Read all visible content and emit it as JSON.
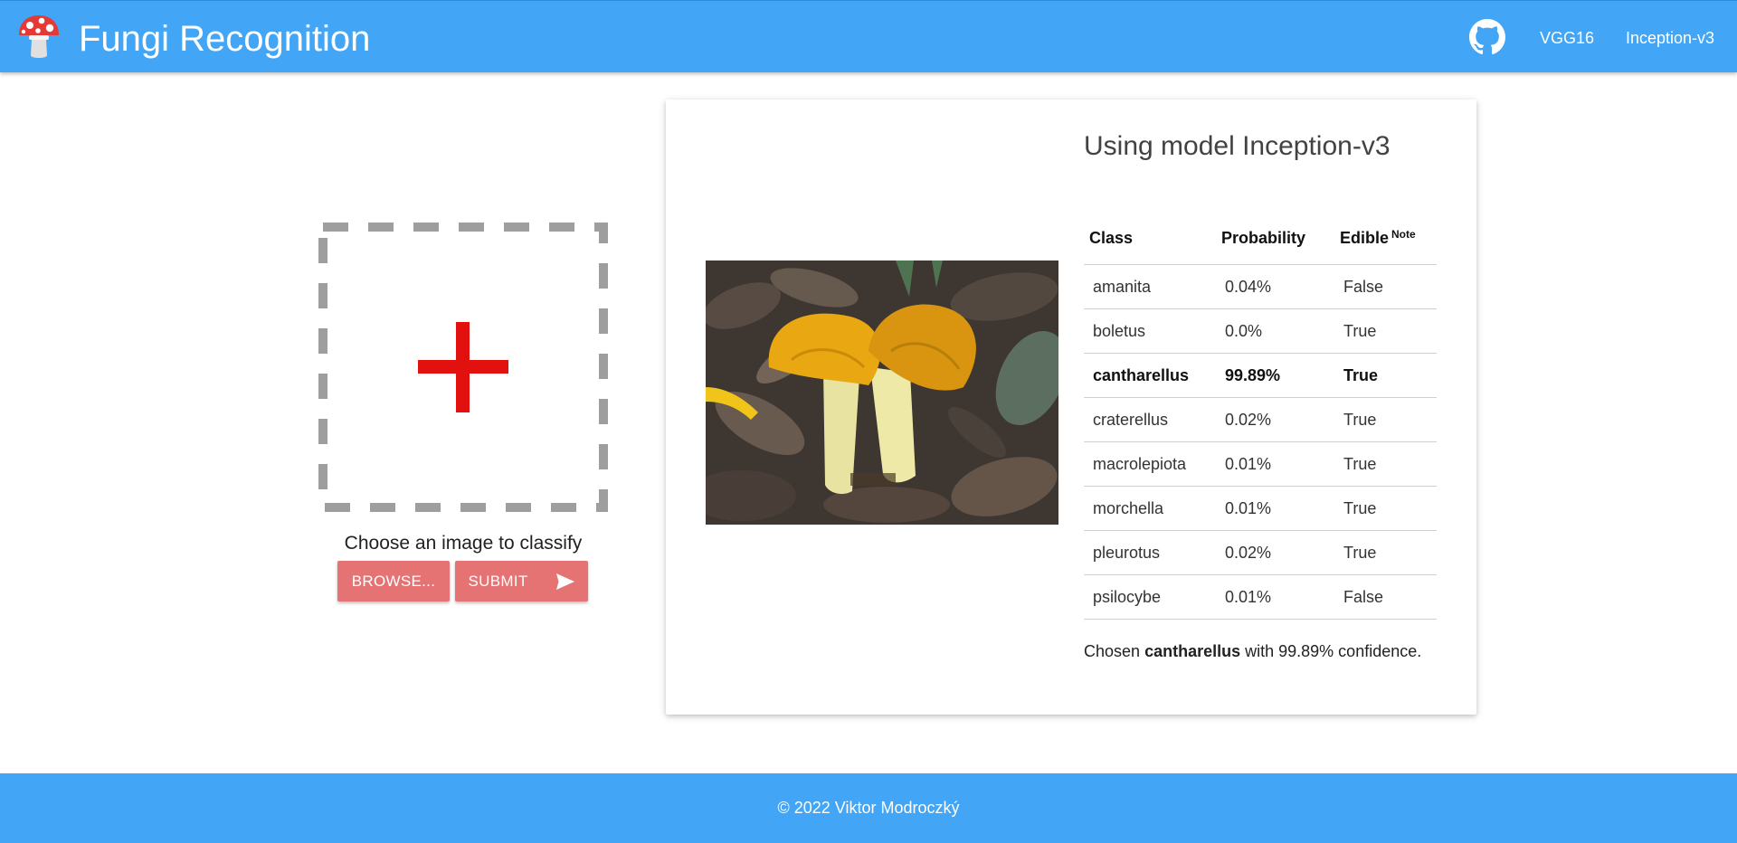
{
  "header": {
    "brand": "Fungi Recognition",
    "nav": [
      {
        "label": "VGG16"
      },
      {
        "label": "Inception-v3"
      }
    ],
    "icons": {
      "logo": "mushroom-logo",
      "github": "github-icon"
    },
    "color": "#42a5f5"
  },
  "upload": {
    "prompt": "Choose an image to classify",
    "browse_label": "BROWSE...",
    "submit_label": "SUBMIT",
    "plus_color": "#e31010",
    "button_color": "#e57373"
  },
  "result": {
    "title": "Using model Inception-v3",
    "columns": {
      "class": "Class",
      "probability": "Probability",
      "edible": "Edible",
      "edible_note": "Note"
    },
    "rows": [
      {
        "class": "amanita",
        "probability": "0.04%",
        "edible": "False"
      },
      {
        "class": "boletus",
        "probability": "0.0%",
        "edible": "True"
      },
      {
        "class": "cantharellus",
        "probability": "99.89%",
        "edible": "True"
      },
      {
        "class": "craterellus",
        "probability": "0.02%",
        "edible": "True"
      },
      {
        "class": "macrolepiota",
        "probability": "0.01%",
        "edible": "True"
      },
      {
        "class": "morchella",
        "probability": "0.01%",
        "edible": "True"
      },
      {
        "class": "pleurotus",
        "probability": "0.02%",
        "edible": "True"
      },
      {
        "class": "psilocybe",
        "probability": "0.01%",
        "edible": "False"
      }
    ],
    "conclusion": {
      "prefix": "Chosen",
      "class": "cantharellus",
      "suffix": "with 99.89% confidence."
    }
  },
  "footer": {
    "text": "© 2022 Viktor Modroczký"
  }
}
